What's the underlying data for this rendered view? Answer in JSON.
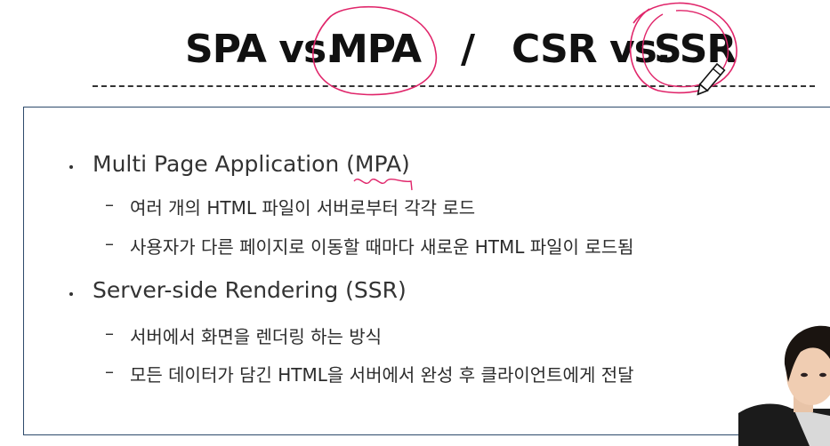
{
  "slide": {
    "title_parts": [
      "SPA vs.",
      "MPA",
      "/",
      "CSR vs.",
      "SSR"
    ],
    "sections": [
      {
        "heading": "Multi Page Application (MPA)",
        "items": [
          "여러 개의 HTML 파일이 서버로부터 각각 로드",
          "사용자가 다른 페이지로 이동할 때마다 새로운 HTML 파일이 로드됨"
        ]
      },
      {
        "heading": "Server-side Rendering (SSR)",
        "items": [
          "서버에서 화면을 렌더링 하는 방식",
          "모든 데이터가 담긴 HTML을 서버에서 완성 후 클라이언트에게 전달"
        ]
      }
    ]
  },
  "colors": {
    "annotation": "#e0256a",
    "box_border": "#2d4a6b"
  },
  "icons": {
    "cursor": "pencil-cursor-icon"
  }
}
